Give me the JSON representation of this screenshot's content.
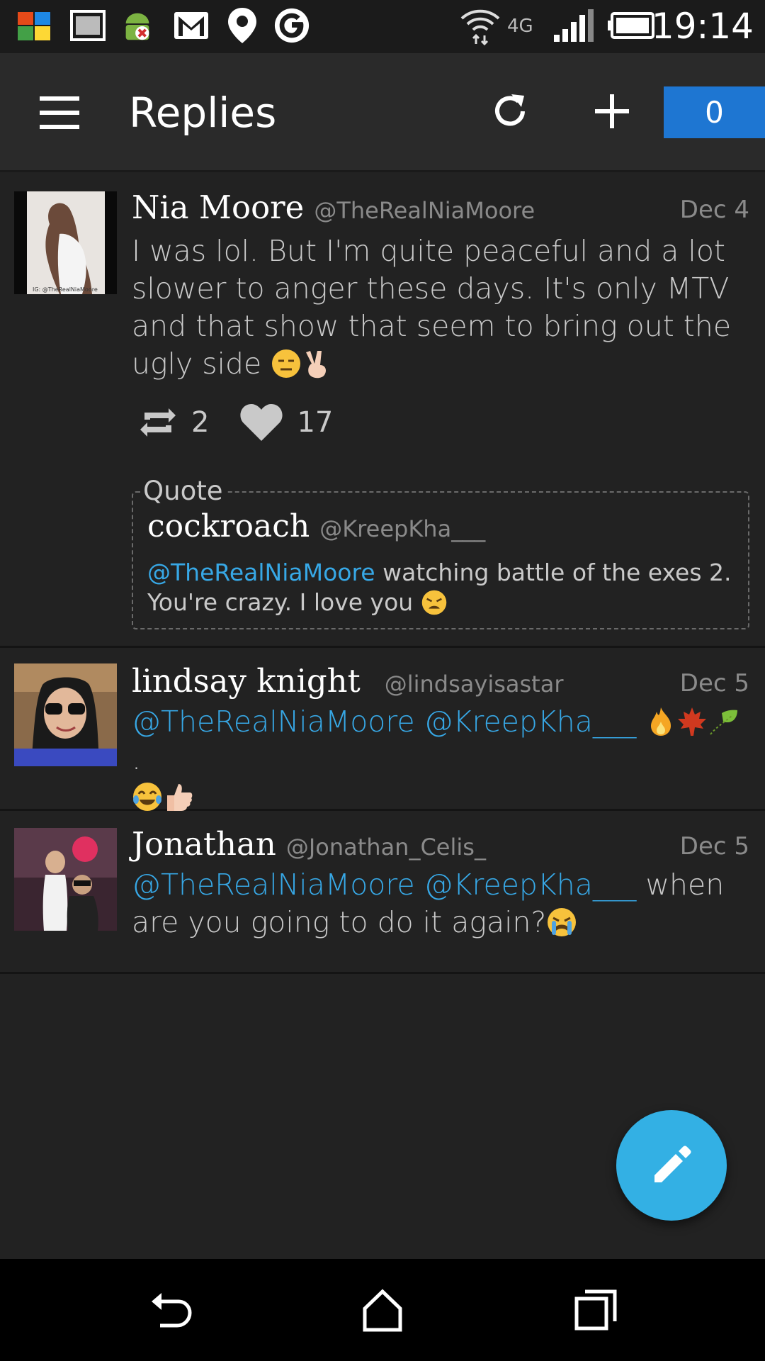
{
  "status_bar": {
    "time": "19:14",
    "network_label": "4G"
  },
  "app_bar": {
    "title": "Replies",
    "notification_count": "0"
  },
  "tweets": [
    {
      "name": "Nia Moore",
      "handle": "@TheRealNiaMoore",
      "date": "Dec 4",
      "text_part1": "I was lol. But I'm quite peaceful and a lot slower to anger these days. It's only MTV and that show that seem to bring out the ugly side",
      "retweets": "2",
      "likes": "17",
      "avatar_caption": "IG: @TheRealNiaMoore",
      "quote": {
        "label": "Quote",
        "name": "cockroach",
        "handle": "@KreepKha___",
        "mention": "@TheRealNiaMoore",
        "text": "watching battle of the exes 2. You're crazy. I love you"
      }
    },
    {
      "name": "lindsay knight",
      "handle": "@lindsayisastar",
      "date": "Dec 5",
      "mention1": "@TheRealNiaMoore",
      "mention2": "@KreepKha___",
      "trailing": "."
    },
    {
      "name": "Jonathan",
      "handle": "@Jonathan_Celis_",
      "date": "Dec 5",
      "mention1": "@TheRealNiaMoore",
      "mention2": "@KreepKha___",
      "text": "when are you going to do it again?"
    }
  ],
  "icons": {
    "menu": "menu-icon",
    "refresh": "refresh-icon",
    "add": "plus-icon",
    "compose": "pencil-icon",
    "back": "back-icon",
    "home": "home-icon",
    "recents": "recents-icon"
  },
  "colors": {
    "accent": "#1e76d2",
    "fab": "#33b0e4",
    "mention": "#37a8e6",
    "background": "#222222"
  }
}
